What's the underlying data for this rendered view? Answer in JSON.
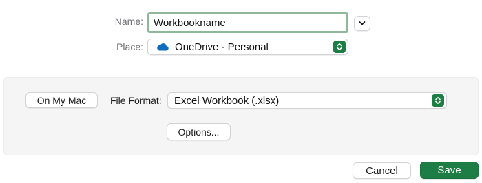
{
  "save_dialog": {
    "name_label": "Name:",
    "name_value": "Workbookname",
    "place_label": "Place:",
    "place_value": "OneDrive - Personal",
    "place_icon": "cloud-icon",
    "expand_icon": "chevron-down-icon",
    "stepper_icon": "up-down-chevron-icon"
  },
  "options": {
    "on_my_mac_label": "On My Mac",
    "file_format_label": "File Format:",
    "file_format_value": "Excel Workbook (.xlsx)",
    "options_button_label": "Options..."
  },
  "footer": {
    "cancel_label": "Cancel",
    "save_label": "Save"
  },
  "colors": {
    "accent": "#1e7d44",
    "focus_ring": "#8fb89a",
    "onedrive_blue": "#0f6cbd"
  }
}
